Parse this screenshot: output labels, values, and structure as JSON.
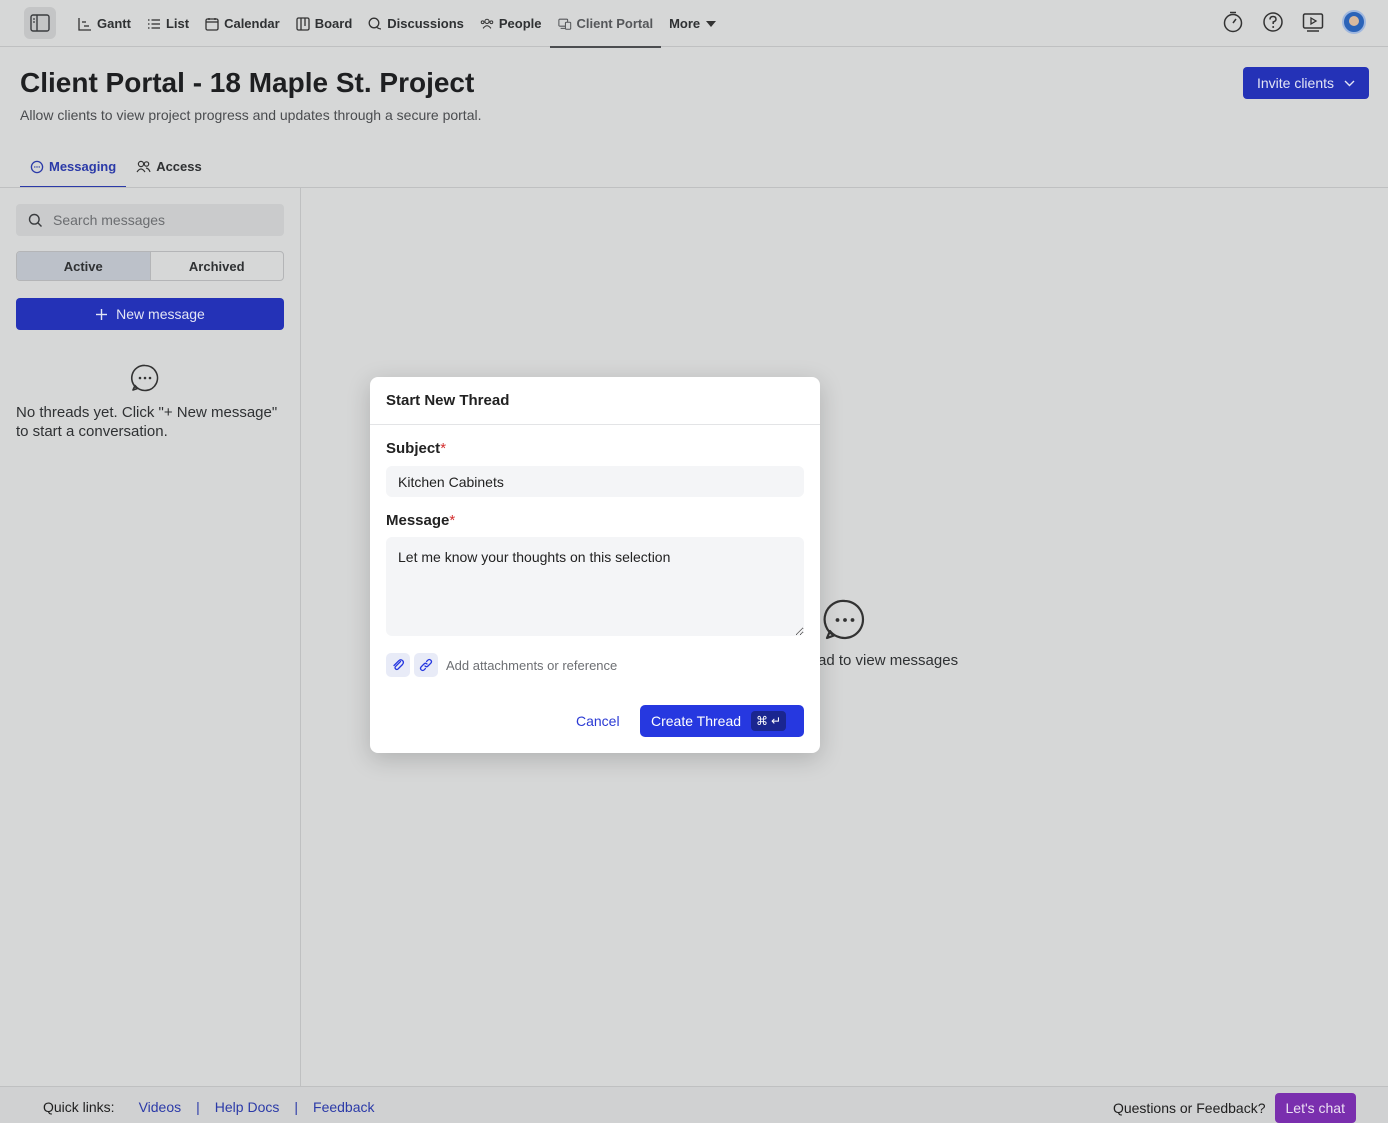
{
  "nav": {
    "items": [
      {
        "label": "Gantt",
        "icon": "gantt-icon"
      },
      {
        "label": "List",
        "icon": "list-icon"
      },
      {
        "label": "Calendar",
        "icon": "calendar-icon"
      },
      {
        "label": "Board",
        "icon": "board-icon"
      },
      {
        "label": "Discussions",
        "icon": "discussions-icon"
      },
      {
        "label": "People",
        "icon": "people-icon"
      },
      {
        "label": "Client Portal",
        "icon": "client-portal-icon"
      },
      {
        "label": "More",
        "icon": "caret-down-icon"
      }
    ],
    "active": "Client Portal"
  },
  "page": {
    "title": "Client Portal - 18 Maple St. Project",
    "subtitle": "Allow clients to view project progress and updates through a secure portal.",
    "invite_label": "Invite clients"
  },
  "tabs": [
    {
      "label": "Messaging",
      "icon": "chat-icon"
    },
    {
      "label": "Access",
      "icon": "users-icon"
    }
  ],
  "left": {
    "search_placeholder": "Search messages",
    "segments": [
      "Active",
      "Archived"
    ],
    "new_message_label": "New message",
    "empty_text": "No threads yet. Click \"+ New message\" to start a conversation."
  },
  "center": {
    "partial_text": "ad to view messages"
  },
  "modal": {
    "title": "Start New Thread",
    "subject_label": "Subject",
    "subject_value": "Kitchen Cabinets",
    "message_label": "Message",
    "message_value": "Let me know your thoughts on this selection",
    "required_mark": "*",
    "attach_text": "Add attachments or reference",
    "cancel_label": "Cancel",
    "create_label": "Create Thread",
    "shortcut_symbol": "⌘",
    "shortcut_key": "↵"
  },
  "footer": {
    "quick_links_label": "Quick links:",
    "links": [
      "Videos",
      "Help Docs",
      "Feedback"
    ],
    "separator": "|",
    "questions_text": "Questions or Feedback?",
    "chat_label": "Let's chat"
  },
  "colors": {
    "primary": "#2638e0",
    "required": "#d32f2f",
    "chat": "#7a2fae"
  }
}
